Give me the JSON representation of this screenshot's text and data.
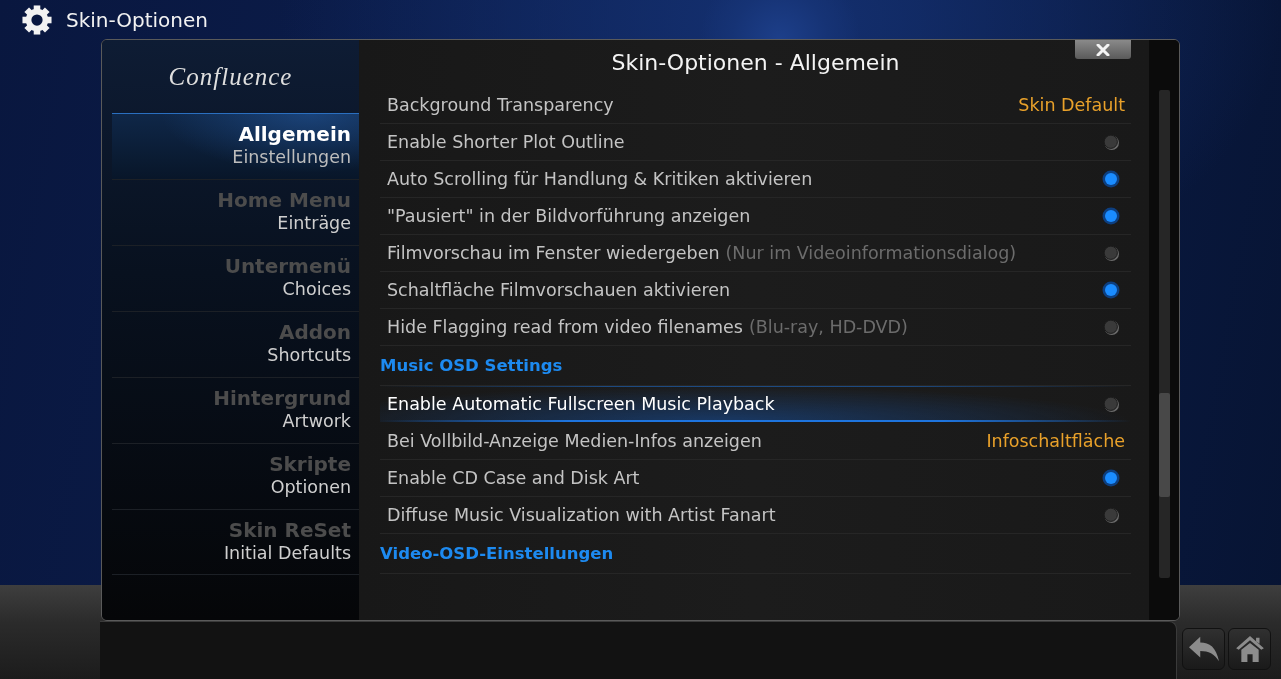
{
  "header": {
    "title": "Skin-Optionen"
  },
  "dialog": {
    "logo": "Confluence",
    "title": "Skin-Optionen - Allgemein",
    "categories": [
      {
        "title": "Allgemein",
        "subtitle": "Einstellungen",
        "selected": true
      },
      {
        "title": "Home Menu",
        "subtitle": "Einträge",
        "selected": false
      },
      {
        "title": "Untermenü",
        "subtitle": "Choices",
        "selected": false
      },
      {
        "title": "Addon",
        "subtitle": "Shortcuts",
        "selected": false
      },
      {
        "title": "Hintergrund",
        "subtitle": "Artwork",
        "selected": false
      },
      {
        "title": "Skripte",
        "subtitle": "Optionen",
        "selected": false
      },
      {
        "title": "Skin ReSet",
        "subtitle": "Initial Defaults",
        "selected": false
      }
    ],
    "settings": [
      {
        "kind": "value",
        "label": "Background Transparency",
        "value": "Skin Default",
        "selected": false
      },
      {
        "kind": "toggle",
        "label": "Enable Shorter Plot Outline",
        "on": false,
        "selected": false
      },
      {
        "kind": "toggle",
        "label": "Auto Scrolling für Handlung & Kritiken aktivieren",
        "on": true,
        "selected": false
      },
      {
        "kind": "toggle",
        "label": "\"Pausiert\" in der Bildvorführung anzeigen",
        "on": true,
        "selected": false
      },
      {
        "kind": "toggle",
        "label": "Filmvorschau im Fenster wiedergeben",
        "note": "(Nur im Videoinformationsdialog)",
        "on": false,
        "selected": false
      },
      {
        "kind": "toggle",
        "label": "Schaltfläche Filmvorschauen aktivieren",
        "on": true,
        "selected": false
      },
      {
        "kind": "toggle",
        "label": "Hide Flagging read from video filenames",
        "note": "(Blu-ray, HD-DVD)",
        "on": false,
        "selected": false
      },
      {
        "kind": "section",
        "label": "Music OSD Settings"
      },
      {
        "kind": "toggle",
        "label": "Enable Automatic Fullscreen Music Playback",
        "on": false,
        "selected": true
      },
      {
        "kind": "value",
        "label": "Bei Vollbild-Anzeige Medien-Infos anzeigen",
        "value": "Infoschaltfläche",
        "selected": false
      },
      {
        "kind": "toggle",
        "label": "Enable CD Case and Disk Art",
        "on": true,
        "selected": false
      },
      {
        "kind": "toggle",
        "label": "Diffuse Music Visualization with Artist Fanart",
        "on": false,
        "selected": false
      },
      {
        "kind": "section",
        "label": "Video-OSD-Einstellungen"
      }
    ]
  }
}
